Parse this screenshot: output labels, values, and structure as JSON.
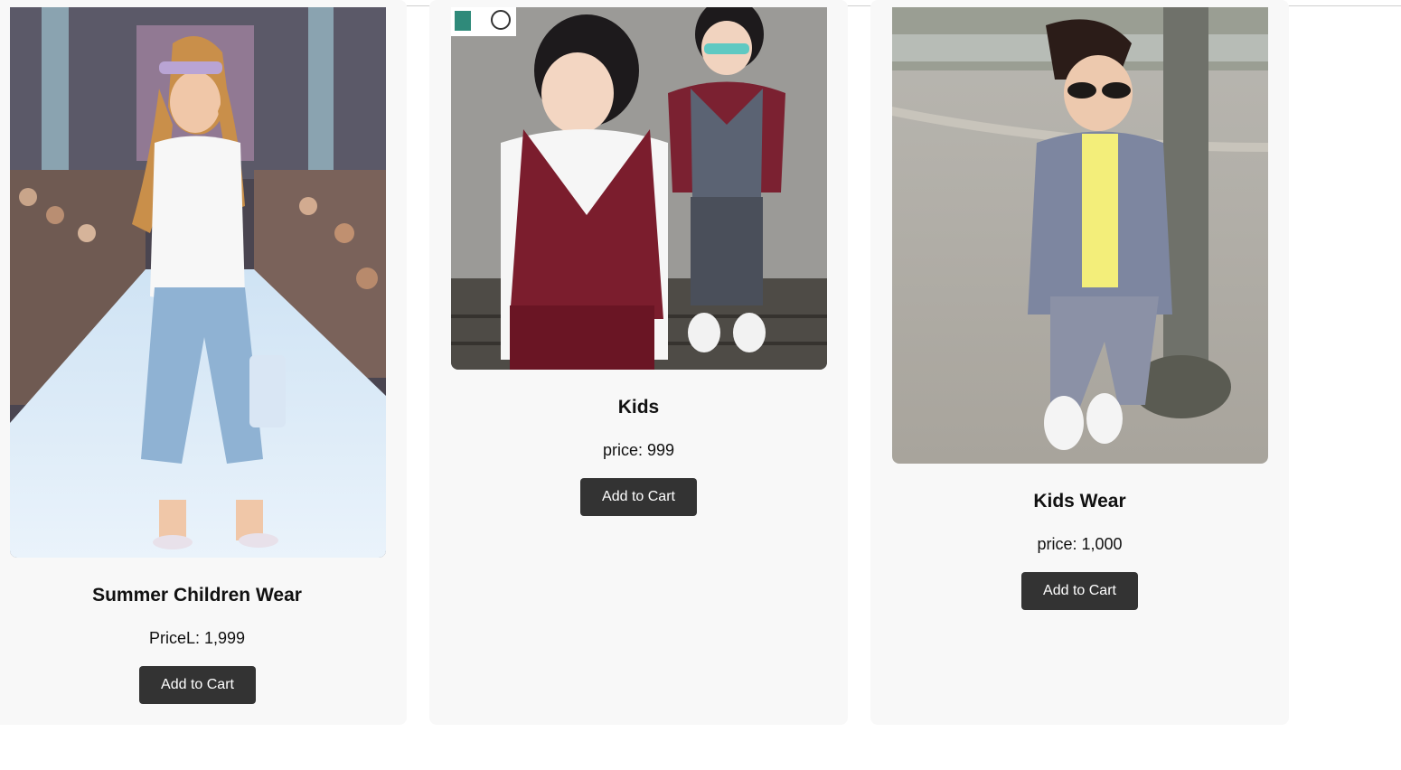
{
  "products": [
    {
      "title": "Summer Children Wear",
      "price": "PriceL: 1,999",
      "button_label": "Add to Cart",
      "image_alt": "girl on runway in white blouse and jeans"
    },
    {
      "title": "Kids",
      "price": "price: 999",
      "button_label": "Add to Cart",
      "image_alt": "two boys in vests and white shirts"
    },
    {
      "title": "Kids Wear",
      "price": "price: 1,000",
      "button_label": "Add to Cart",
      "image_alt": "boy in grey cardigan and sunglasses leaning on pole"
    }
  ],
  "colors": {
    "card_bg": "#f8f8f8",
    "button_bg": "#333333",
    "button_text": "#ffffff",
    "text": "#111111"
  }
}
